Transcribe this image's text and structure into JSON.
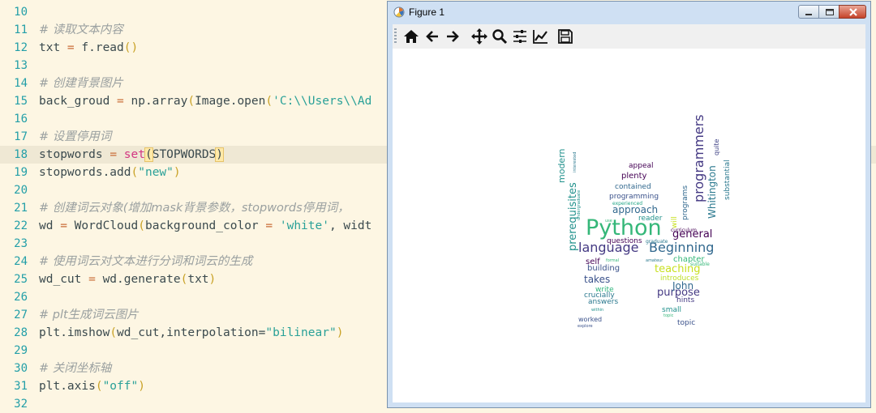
{
  "editor": {
    "lines": [
      {
        "n": "10"
      },
      {
        "n": "11",
        "comment": "# 读取文本内容"
      },
      {
        "n": "12",
        "var": "txt",
        "rest": "f.read"
      },
      {
        "n": "13"
      },
      {
        "n": "14",
        "comment": "# 创建背景图片"
      },
      {
        "n": "15",
        "var": "back_groud",
        "rest": "np.array",
        "inner": "Image.open",
        "arg": "'C:\\\\Users\\\\Ad"
      },
      {
        "n": "16"
      },
      {
        "n": "17",
        "comment": "# 设置停用词"
      },
      {
        "n": "18",
        "var": "stopwords",
        "fn": "set",
        "arg": "STOPWORDS"
      },
      {
        "n": "19",
        "call": "stopwords.add",
        "arg": "\"new\""
      },
      {
        "n": "20"
      },
      {
        "n": "21",
        "comment": "# 创建词云对象(增加mask背景参数，stopwords停用词，"
      },
      {
        "n": "22",
        "var": "wd",
        "rest": "WordCloud",
        "arg": "background_color",
        "arg2": "'white'",
        "tail": ", widt"
      },
      {
        "n": "23"
      },
      {
        "n": "24",
        "comment": "# 使用词云对文本进行分词和词云的生成"
      },
      {
        "n": "25",
        "var": "wd_cut",
        "rest": "wd.generate",
        "arg": "txt"
      },
      {
        "n": "26"
      },
      {
        "n": "27",
        "comment": "# plt生成词云图片"
      },
      {
        "n": "28",
        "call": "plt.imshow",
        "arg": "wd_cut,interpolation=",
        "arg2": "\"bilinear\""
      },
      {
        "n": "29"
      },
      {
        "n": "30",
        "comment": "# 关闭坐标轴"
      },
      {
        "n": "31",
        "call": "plt.axis",
        "arg": "\"off\""
      },
      {
        "n": "32"
      }
    ]
  },
  "figure": {
    "title": "Figure 1",
    "toolbar": [
      "home-icon",
      "back-arrow-icon",
      "forward-arrow-icon",
      "pan-icon",
      "zoom-icon",
      "subplots-icon",
      "axes-icon",
      "save-icon"
    ],
    "words": [
      {
        "t": "Python",
        "c": "#35b779"
      },
      {
        "t": "language",
        "c": "#443983"
      },
      {
        "t": "Beginning",
        "c": "#31688e"
      },
      {
        "t": "programmers",
        "c": "#443983"
      },
      {
        "t": "prerequisites",
        "c": "#21918c"
      },
      {
        "t": "Whitington",
        "c": "#2a788e"
      },
      {
        "t": "general",
        "c": "#440154"
      },
      {
        "t": "approach",
        "c": "#31688e"
      },
      {
        "t": "teaching",
        "c": "#c8e020"
      },
      {
        "t": "purpose",
        "c": "#443983"
      },
      {
        "t": "takes",
        "c": "#3b528b"
      },
      {
        "t": "John",
        "c": "#31688e"
      },
      {
        "t": "programs",
        "c": "#31688e"
      },
      {
        "t": "modern",
        "c": "#21918c"
      },
      {
        "t": "plenty",
        "c": "#440154"
      },
      {
        "t": "self",
        "c": "#440154"
      },
      {
        "t": "building",
        "c": "#3b528b"
      },
      {
        "t": "chapter",
        "c": "#35b779"
      },
      {
        "t": "introduces",
        "c": "#bddf26"
      },
      {
        "t": "programming",
        "c": "#3b528b"
      },
      {
        "t": "contained",
        "c": "#31688e"
      },
      {
        "t": "substantial",
        "c": "#2a788e"
      },
      {
        "t": "reader",
        "c": "#21918c"
      },
      {
        "t": "questions",
        "c": "#440154"
      },
      {
        "t": "appeal",
        "c": "#440154"
      },
      {
        "t": "quite",
        "c": "#414487"
      },
      {
        "t": "write",
        "c": "#2fb47c"
      },
      {
        "t": "crucially",
        "c": "#2a788e"
      },
      {
        "t": "answers",
        "c": "#2a788e"
      },
      {
        "t": "hints",
        "c": "#443983"
      },
      {
        "t": "small",
        "c": "#21918c"
      },
      {
        "t": "topic",
        "c": "#3b528b"
      },
      {
        "t": "worked",
        "c": "#3b528b"
      },
      {
        "t": "will",
        "c": "#c8e020"
      },
      {
        "t": "experienced",
        "c": "#21a585"
      },
      {
        "t": "curriculum",
        "c": "#440154"
      },
      {
        "t": "graduate",
        "c": "#2a788e"
      },
      {
        "t": "suitable",
        "c": "#35b779"
      },
      {
        "t": "interested",
        "c": "#2a788e"
      },
      {
        "t": "undergraduate",
        "c": "#21918c"
      },
      {
        "t": "formal",
        "c": "#35b779"
      },
      {
        "t": "amateur",
        "c": "#2a788e"
      },
      {
        "t": "within",
        "c": "#21918c"
      },
      {
        "t": "explore",
        "c": "#3b528b"
      },
      {
        "t": "use",
        "c": "#35b779"
      },
      {
        "t": "topic",
        "c": "#35b779"
      }
    ]
  }
}
